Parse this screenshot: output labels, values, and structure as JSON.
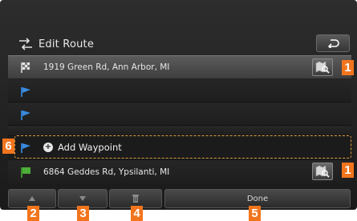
{
  "header": {
    "title": "Edit Route",
    "title_icon": "route-edit-icon",
    "back_icon": "back-arrow-icon"
  },
  "route": {
    "start": {
      "address": "1919 Green Rd, Ann Arbor, MI",
      "icon": "start-flag-icon"
    },
    "waypoints": [
      {
        "icon": "waypoint-flag-icon"
      },
      {
        "icon": "waypoint-flag-icon"
      }
    ],
    "add_waypoint": {
      "label": "Add Waypoint",
      "icon": "plus-circle-icon"
    },
    "destination": {
      "address": "6864 Geddes Rd, Ypsilanti, MI",
      "icon": "destination-flag-icon"
    }
  },
  "buttons": {
    "up_icon": "triangle-up-icon",
    "down_icon": "triangle-down-icon",
    "delete_icon": "trash-icon",
    "done_label": "Done",
    "poi_search_icon": "map-search-icon"
  },
  "callouts": [
    "1",
    "1",
    "2",
    "3",
    "4",
    "5",
    "6"
  ],
  "colors": {
    "callout": "#f2751d",
    "outline": "#d89a3c",
    "start_flag": "#cfcfcf",
    "waypoint_flag": "#3a8be0",
    "destination_flag": "#4caf3a"
  }
}
